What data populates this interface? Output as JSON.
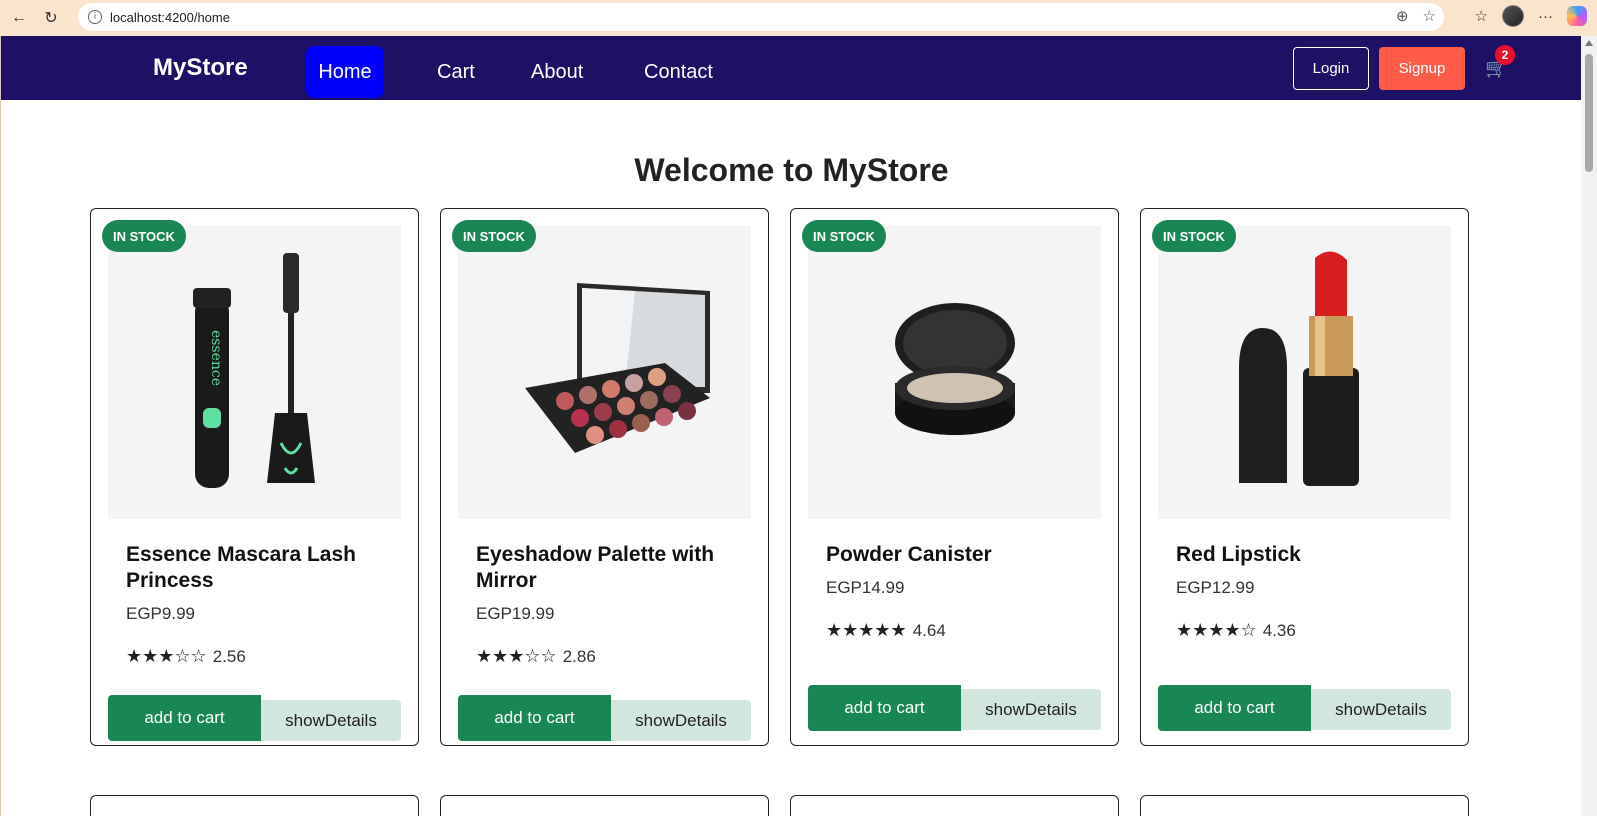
{
  "browser": {
    "url": "localhost:4200/home"
  },
  "navbar": {
    "brand": "MyStore",
    "links": [
      "Home",
      "Cart",
      "About",
      "Contact"
    ],
    "login_label": "Login",
    "signup_label": "Signup",
    "cart_count": "2"
  },
  "main": {
    "heading": "Welcome to MyStore"
  },
  "products": [
    {
      "badge": "IN STOCK",
      "title": "Essence Mascara Lash Princess",
      "price": "EGP9.99",
      "stars": "★★★☆☆",
      "rating": "2.56",
      "add_label": "add to cart",
      "details_label": "showDetails"
    },
    {
      "badge": "IN STOCK",
      "title": "Eyeshadow Palette with Mirror",
      "price": "EGP19.99",
      "stars": "★★★☆☆",
      "rating": "2.86",
      "add_label": "add to cart",
      "details_label": "showDetails"
    },
    {
      "badge": "IN STOCK",
      "title": "Powder Canister",
      "price": "EGP14.99",
      "stars": "★★★★★",
      "rating": "4.64",
      "add_label": "add to cart",
      "details_label": "showDetails"
    },
    {
      "badge": "IN STOCK",
      "title": "Red Lipstick",
      "price": "EGP12.99",
      "stars": "★★★★☆",
      "rating": "4.36",
      "add_label": "add to cart",
      "details_label": "showDetails"
    }
  ]
}
